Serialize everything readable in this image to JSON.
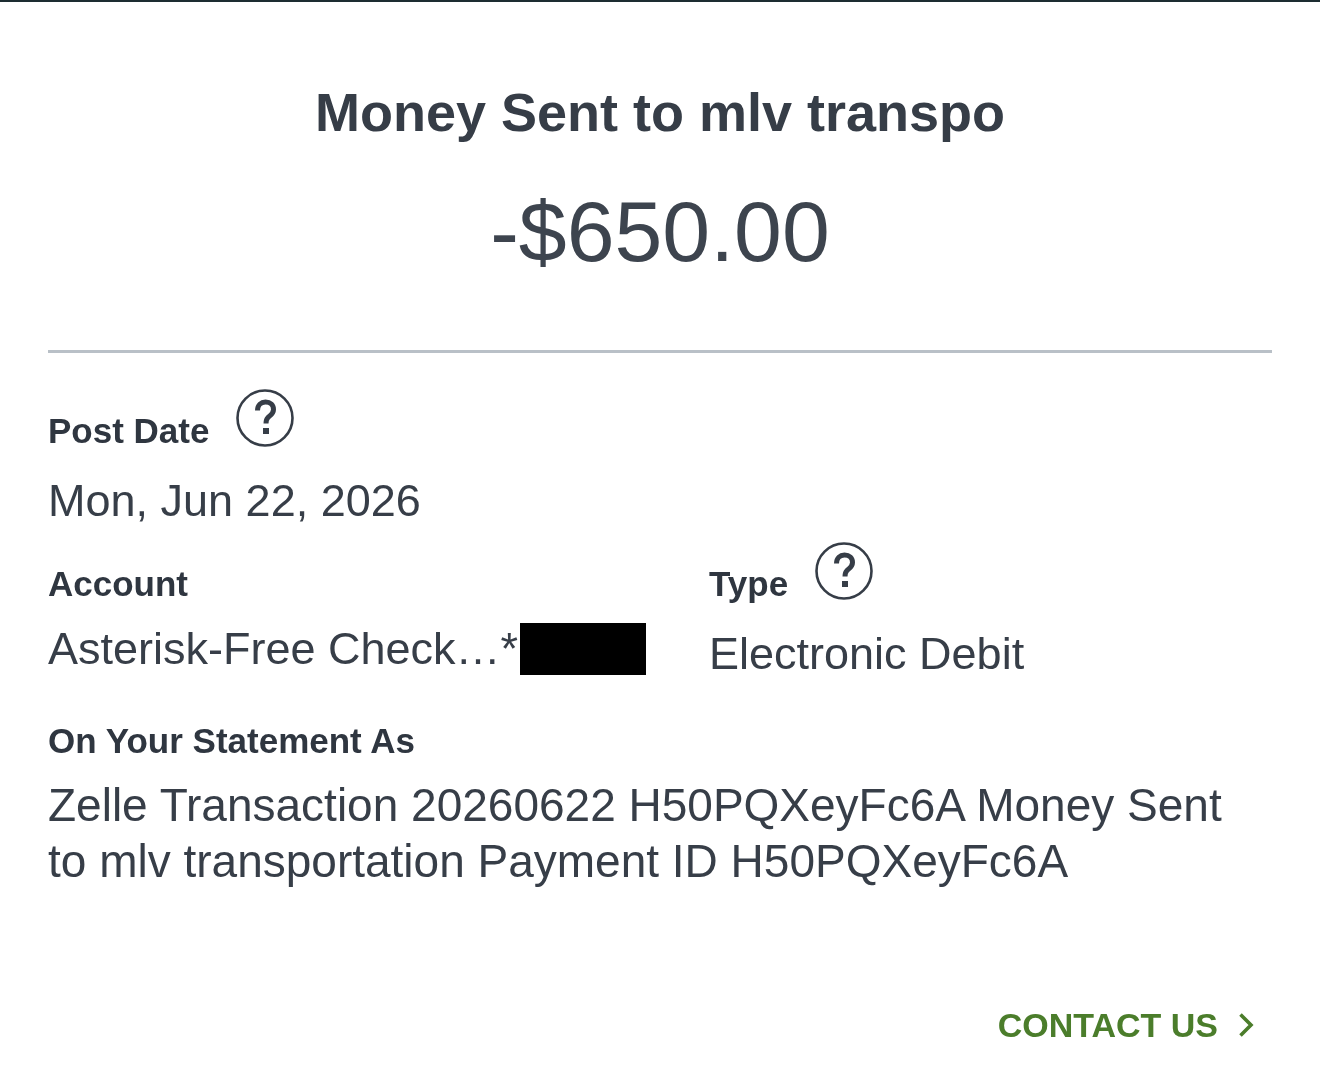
{
  "header": {
    "title": "Money Sent to mlv transpo",
    "amount": "-$650.00"
  },
  "post_date": {
    "label": "Post Date",
    "value": "Mon, Jun 22, 2026",
    "help": true
  },
  "account": {
    "label": "Account",
    "value": "Asterisk-Free Check…*",
    "redacted": true
  },
  "type": {
    "label": "Type",
    "value": "Electronic Debit",
    "help": true
  },
  "statement": {
    "label": "On Your Statement As",
    "value": "Zelle Transaction 20260622 H50PQXeyFc6A Money Sent to mlv transportation Payment ID H50PQXeyFc6A"
  },
  "contact_link": {
    "label": "CONTACT US"
  }
}
